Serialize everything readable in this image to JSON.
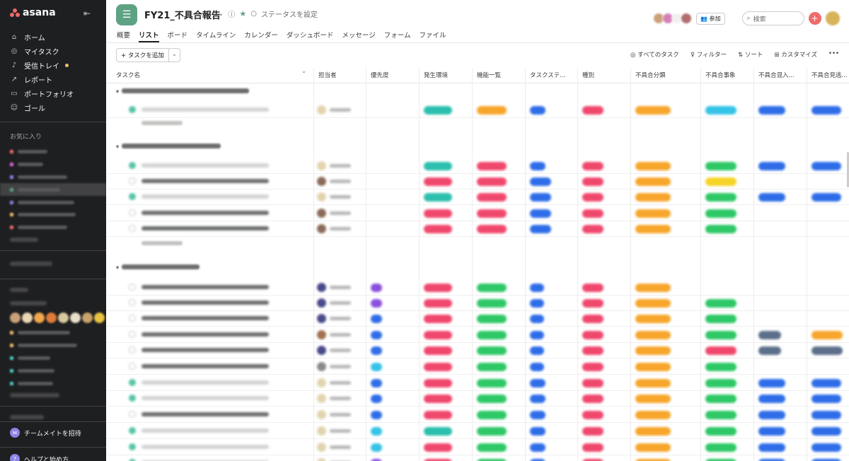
{
  "brand": {
    "name": "asana"
  },
  "nav": [
    {
      "icon": "home-icon",
      "glyph": "⌂",
      "label": "ホーム"
    },
    {
      "icon": "check-circle-icon",
      "glyph": "◎",
      "label": "マイタスク"
    },
    {
      "icon": "bell-icon",
      "glyph": "♪",
      "label": "受信トレイ"
    },
    {
      "icon": "chart-icon",
      "glyph": "↗",
      "label": "レポート"
    },
    {
      "icon": "portfolio-icon",
      "glyph": "▭",
      "label": "ポートフォリオ"
    },
    {
      "icon": "person-icon",
      "glyph": "☺",
      "label": "ゴール"
    }
  ],
  "favorites_heading": "お気に入り",
  "invite_label": "チームメイトを招待",
  "help_label": "ヘルプと始め方",
  "project": {
    "title": "FY21_不具合報告",
    "status_label": "ステータスを設定",
    "join_label": "参加",
    "search_placeholder": "検索"
  },
  "tabs": [
    "概要",
    "リスト",
    "ボード",
    "タイムライン",
    "カレンダー",
    "ダッシュボード",
    "メッセージ",
    "フォーム",
    "ファイル"
  ],
  "active_tab": "リスト",
  "add_task_label": "タスクを追加",
  "toolbar": {
    "all_tasks": "すべてのタスク",
    "filter": "フィルター",
    "sort": "ソート",
    "customize": "カスタマイズ"
  },
  "columns": [
    "タスク名",
    "担当者",
    "優先度",
    "発生環境",
    "機能一覧",
    "タスクステ...",
    "種別",
    "不具合分類",
    "不具合事象",
    "不具合混入...",
    "不具合見逃..."
  ],
  "colors": {
    "teal": "#2bbfae",
    "orange": "#f7a62b",
    "blue": "#2f6de8",
    "pink": "#f0486d",
    "cyan": "#35c3e8",
    "green": "#2ec866",
    "purple": "#8b4fe0",
    "yellow": "#f5d327",
    "slate": "#5c6f8a"
  }
}
